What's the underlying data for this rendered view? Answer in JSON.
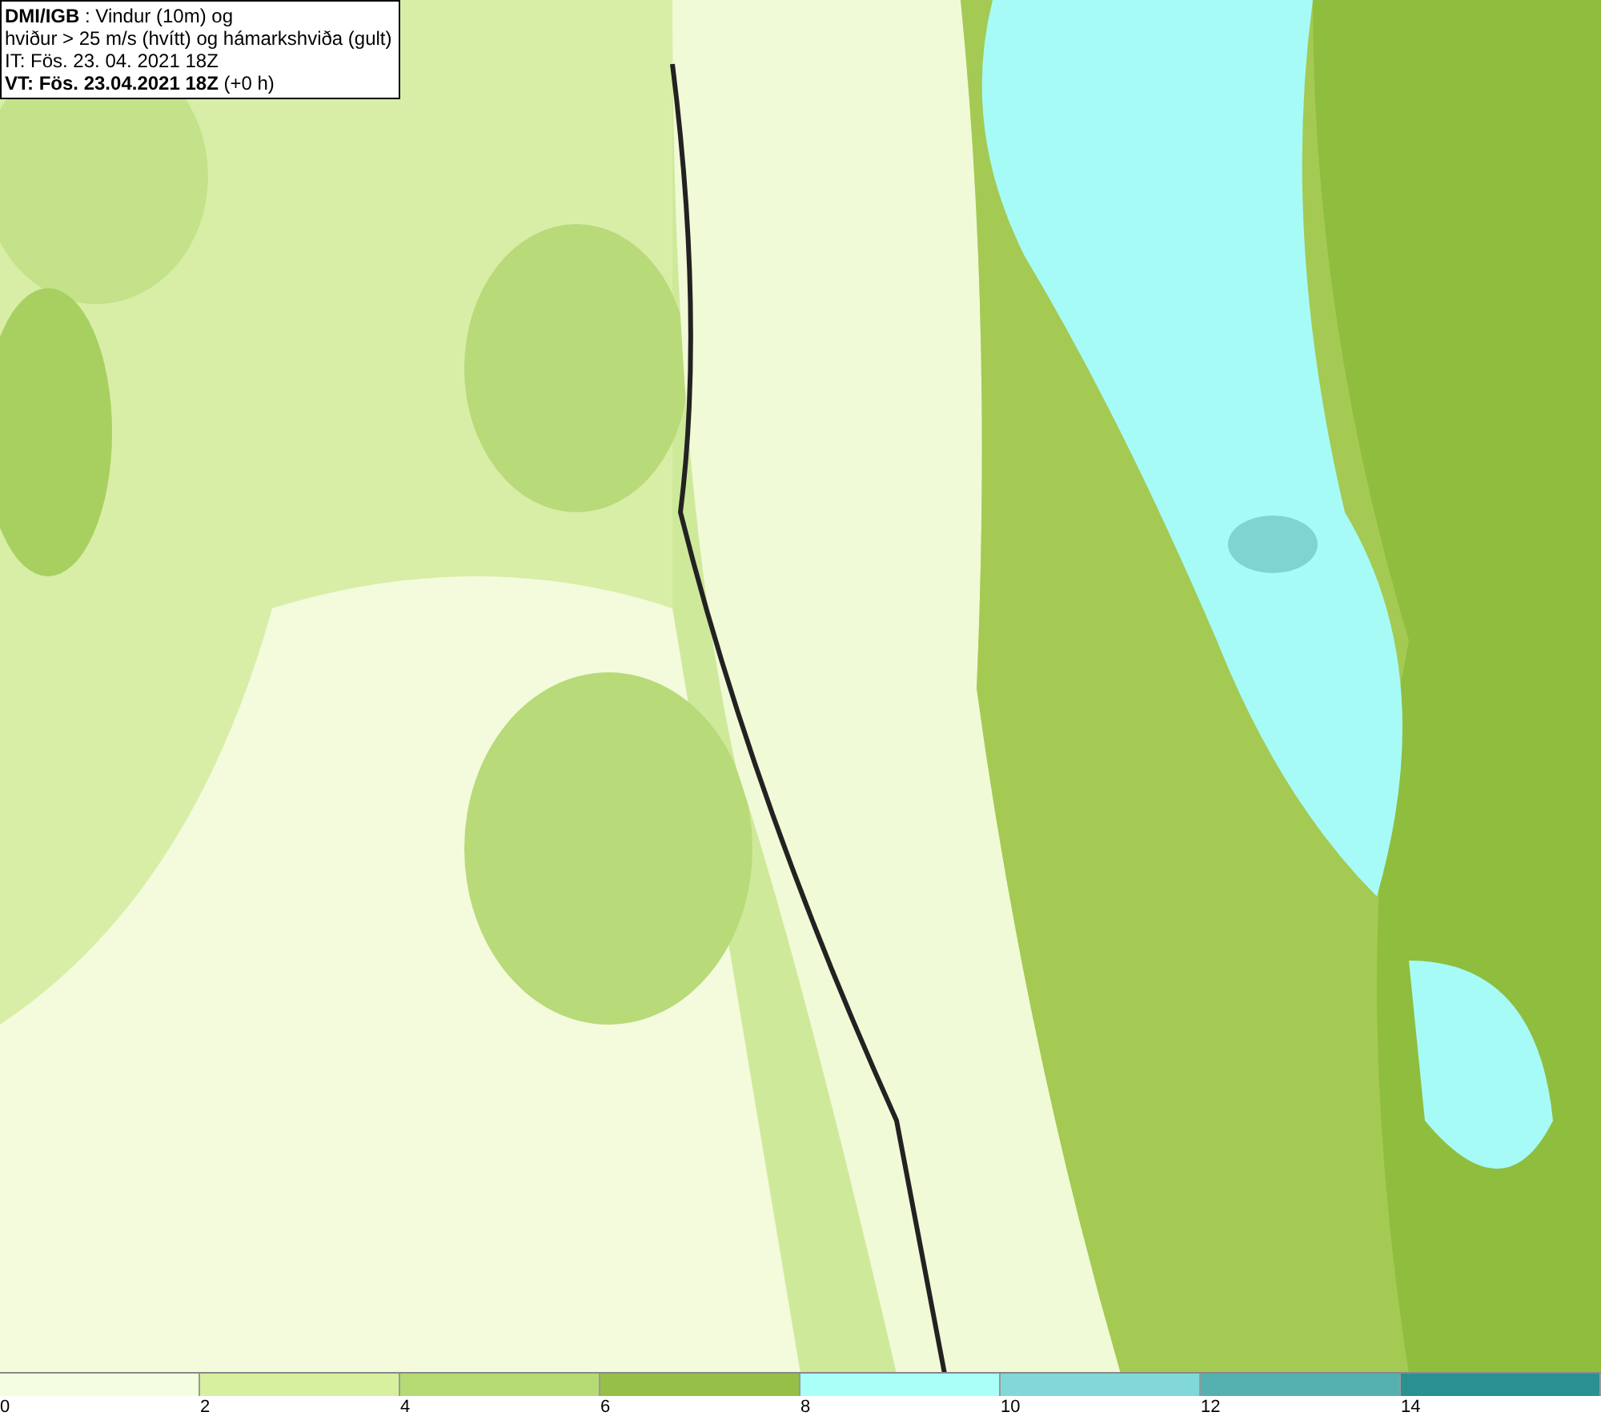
{
  "header": {
    "lines": [
      "**DMI/IGB** : Vindur (10m) og",
      "hviður > 25 m/s (hvítt) og hámarkshviða (gult)",
      "IT: Fös. 23. 04. 2021 18Z",
      "**VT: Fös. 23.04.2021 18Z** (+0 h)"
    ]
  },
  "legend": [
    {
      "label": "0",
      "color": "#f5fde0"
    },
    {
      "label": "2",
      "color": "#d6f0a0"
    },
    {
      "label": "4",
      "color": "#b6da74"
    },
    {
      "label": "6",
      "color": "#96bf48"
    },
    {
      "label": "8",
      "color": "#aafff9"
    },
    {
      "label": "10",
      "color": "#82d8d8"
    },
    {
      "label": "12",
      "color": "#55b0b0"
    },
    {
      "label": "14",
      "color": "#2a9190"
    }
  ]
}
